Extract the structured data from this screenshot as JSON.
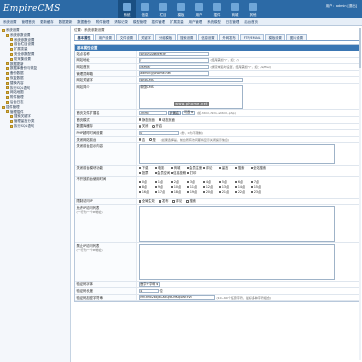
{
  "brand": {
    "logo_text": "EmpireCMS"
  },
  "mainnav": [
    {
      "label": "系统"
    },
    {
      "label": "信息"
    },
    {
      "label": "栏目"
    },
    {
      "label": "模板"
    },
    {
      "label": "用户"
    },
    {
      "label": "插件"
    },
    {
      "label": "商城"
    },
    {
      "label": "其他"
    }
  ],
  "userinfo": "用户：admin [退出]",
  "subnav": [
    "系统设置",
    "管理首页",
    "更新缓存",
    "数据更新",
    "数据备份",
    "附件管理",
    "清除记录",
    "模型管理",
    "插件管理",
    "扩展变量",
    "用户管理",
    "系统模型",
    "日志管理",
    "后台首页"
  ],
  "sidebar": [
    {
      "level": 1,
      "label": "系统设置"
    },
    {
      "level": 2,
      "label": "系统参数设置"
    },
    {
      "level": 3,
      "label": "系统参数设置"
    },
    {
      "level": 3,
      "label": "前台栏目设置"
    },
    {
      "level": 3,
      "label": "扩展变量"
    },
    {
      "level": 3,
      "label": "安全参数配置"
    },
    {
      "level": 3,
      "label": "防采集设置"
    },
    {
      "level": 2,
      "label": "数据更新"
    },
    {
      "level": 2,
      "label": "数据库备份与恢复"
    },
    {
      "level": 2,
      "label": "备份数据"
    },
    {
      "level": 2,
      "label": "恢复数据"
    },
    {
      "level": 2,
      "label": "替换内容"
    },
    {
      "level": 2,
      "label": "执行SQL语句"
    },
    {
      "level": 2,
      "label": "网站地图"
    },
    {
      "level": 2,
      "label": "附件管理"
    },
    {
      "level": 2,
      "label": "后台日志"
    },
    {
      "level": 1,
      "label": "插件管理"
    },
    {
      "level": 2,
      "label": "管理插件"
    },
    {
      "level": 3,
      "label": "搜索关键字"
    },
    {
      "level": 3,
      "label": "管理留言分类"
    },
    {
      "level": 3,
      "label": "执行SQL语句"
    }
  ],
  "breadcrumb": "位置：系统参数设置",
  "tabs": [
    {
      "label": "基本属性",
      "active": true
    },
    {
      "label": "用户设置",
      "active": false
    },
    {
      "label": "文件设置",
      "active": false
    },
    {
      "label": "关键字",
      "active": false
    },
    {
      "label": "分组模板",
      "active": false
    },
    {
      "label": "搜索设置",
      "active": false
    },
    {
      "label": "信息设置",
      "active": false
    },
    {
      "label": "外网发布",
      "active": false
    },
    {
      "label": "FTP/EMAIL",
      "active": false
    },
    {
      "label": "模板设置",
      "active": false
    },
    {
      "label": "图片设置",
      "active": false
    }
  ],
  "form": {
    "title": "基本属性设置",
    "site_name_label": "站点名称",
    "site_name_value": "帝国内容管理系统",
    "site_url_label": "网站地址",
    "site_url_value": "/",
    "site_url_hint": "(结尾需加\"/\"，如：/)",
    "home_url_label": "网站首页",
    "home_url_value": "/e/file/",
    "home_url_hint": "(绑定域名时设置，结尾需加\"/\"，如：/e/file/)",
    "admin_email_label": "管理员邮箱",
    "admin_email_value": "admin@phome.net",
    "site_keywords_label": "网站关键字",
    "site_keywords_value": "帝国CMS",
    "site_desc_label": "网站简介",
    "site_desc_value": "帝国CMS",
    "filetype_label": "首页文件扩展名",
    "filetype_value": ".html",
    "filetype_button": "扩展名",
    "filetype_select": "可选",
    "filetype_hint": "(如.html,.htm,.shtml,.php)",
    "homepage_mode_label": "首页模式",
    "homepage_mode_options": [
      "静态页面",
      "动态页面"
    ],
    "homepage_mode_selected": 0,
    "sqlcache_label": "数据库缓存",
    "sqlcache_options": [
      "关闭",
      "开启"
    ],
    "sqlcache_selected": 1,
    "php_mem_label": "PHP超时时间设置",
    "php_mem_value": "0",
    "php_mem_hint": "(秒，0为不限制)",
    "close_site_label": "关闭网站前台",
    "close_site_options": [
      "否",
      "是"
    ],
    "close_site_selected": 0,
    "close_site_hint": "(如果选择是，前台所有访问都将显示关闭提示信息)",
    "close_tips_label": "关闭前台显示内容",
    "close_tips_value": "",
    "close_modules_label": "关闭前台模块功能",
    "close_modules": [
      "下载",
      "电影",
      "商城",
      "会员注册",
      "评论",
      "留言",
      "搜索",
      "全站搜索",
      "投票",
      "会员空间",
      "信息投稿",
      "打印"
    ],
    "time_label": "不开放前台使用时间",
    "time_options": [
      "0点",
      "1点",
      "2点",
      "3点",
      "4点",
      "5点",
      "6点",
      "7点",
      "8点",
      "9点",
      "10点",
      "11点",
      "12点",
      "13点",
      "14点",
      "15点",
      "16点",
      "17点",
      "18点",
      "19点",
      "20点",
      "21点",
      "22点",
      "23点"
    ],
    "ip_limit_label": "限制访问IP",
    "ip_limit_options": [
      "全局生效",
      "发布",
      "评论",
      "搜索"
    ],
    "ip_allow_label": "允许IP访问列表",
    "ip_allow_sub": "(一行为一个IP地址)",
    "ip_allow_value": "",
    "ip_deny_label": "禁止IP访问列表",
    "ip_deny_sub": "(一行为一个IP地址)",
    "ip_deny_value": "",
    "verify_label": "验证码字体",
    "verify_value": "数字+字母",
    "verify_len_label": "验证码长度",
    "verify_len_value": "4",
    "verify_len_unit": "位",
    "verify_key_label": "验证码加密字符串",
    "verify_key_value": "Mn3Mx2bxJkLX8uJ9D9Kq4Wf3Vt",
    "verify_key_hint": "(10~60个任意字符，最好多种字符组合)"
  },
  "watermark": "www.phome.net"
}
